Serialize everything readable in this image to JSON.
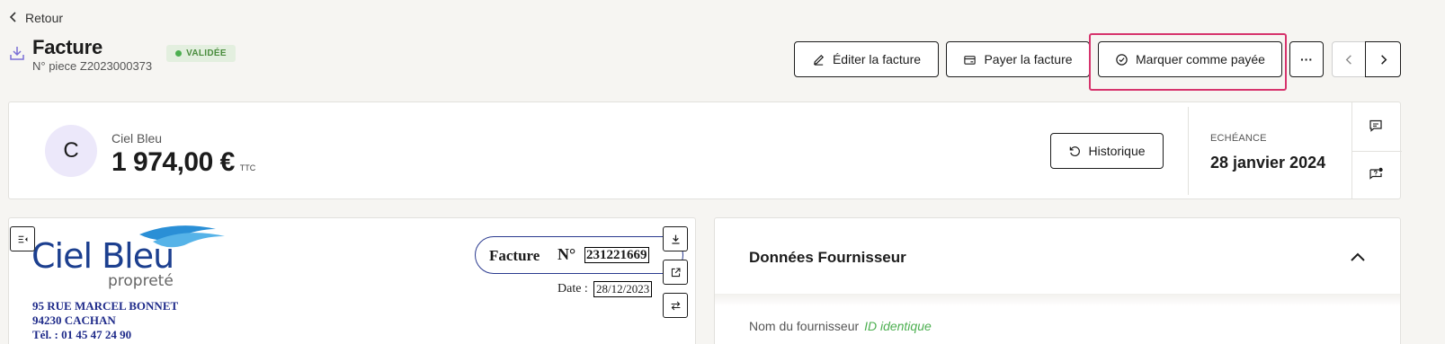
{
  "nav": {
    "back_label": "Retour"
  },
  "header": {
    "title": "Facture",
    "piece": "N° piece Z2023000373",
    "status": "VALIDÉE"
  },
  "actions": {
    "edit": "Éditer la facture",
    "pay": "Payer la facture",
    "mark_paid": "Marquer comme payée",
    "more": "···"
  },
  "summary": {
    "avatar_letter": "C",
    "supplier": "Ciel Bleu",
    "amount": "1 974,00 €",
    "amount_suffix": "TTC",
    "history": "Historique",
    "due_label": "ECHÉANCE",
    "due_date": "28 janvier 2024"
  },
  "document": {
    "logo_text": "Ciel Bleu",
    "logo_sub": "propreté",
    "address_line1": "95   RUE MARCEL BONNET",
    "address_line2": "94230     CACHAN",
    "address_line3": "Tél. :   01 45 47 24 90",
    "facture_label": "Facture",
    "number_label": "N°",
    "number": "231221669",
    "date_label": "Date :",
    "date": "28/12/2023"
  },
  "data_panel": {
    "title": "Données Fournisseur",
    "field_label": "Nom du fournisseur",
    "field_value": "ID identique"
  },
  "colors": {
    "highlight": "#d6336c",
    "status_green": "#4caf50",
    "brand_blue": "#1c3f8f",
    "avatar_bg": "#ece8fa"
  }
}
